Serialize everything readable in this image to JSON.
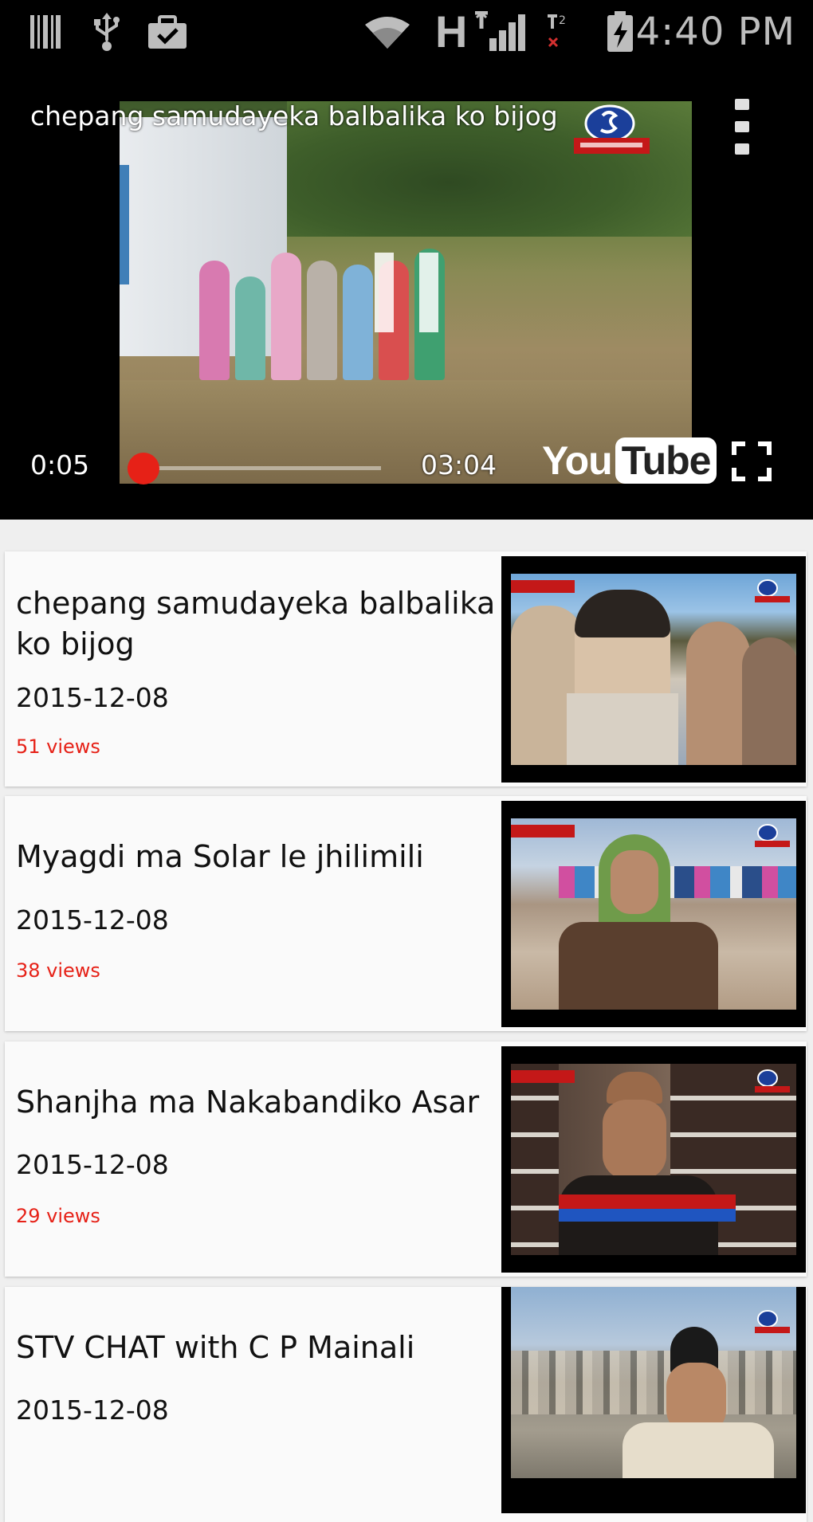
{
  "status_bar": {
    "time": "4:40 PM",
    "network_type": "H",
    "sim2_label": "2"
  },
  "player": {
    "title": "chepang samudayeka balbalika ko bijog",
    "current_time": "0:05",
    "duration": "03:04",
    "progress": 0.027,
    "logo_you": "You",
    "logo_tube": "Tube"
  },
  "videos": [
    {
      "title": "chepang samudayeka balbalika ko bijog",
      "date": "2015-12-08",
      "views": "51  views"
    },
    {
      "title": "Myagdi ma Solar le jhilimili",
      "date": "2015-12-08",
      "views": "38  views"
    },
    {
      "title": "Shanjha ma Nakabandiko Asar",
      "date": "2015-12-08",
      "views": "29  views"
    },
    {
      "title": "STV CHAT with C P Mainali",
      "date": "2015-12-08",
      "views": ""
    }
  ],
  "colors": {
    "accent": "#e62117",
    "status_bar_bg": "#000000",
    "list_bg": "#efefef",
    "card_bg": "#fafafa"
  }
}
